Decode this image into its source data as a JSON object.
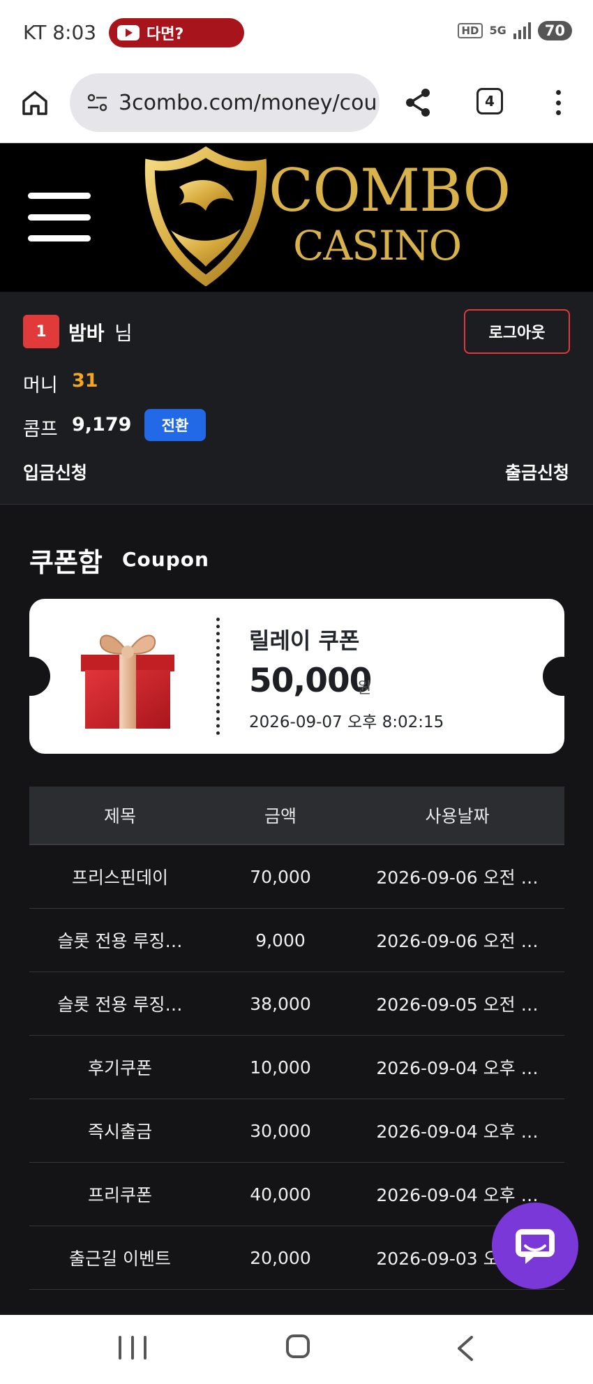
{
  "status_bar": {
    "carrier_time": "KT 8:03",
    "notification_text": "다면?",
    "hd": "HD",
    "network": "5G",
    "battery": "70"
  },
  "browser": {
    "url": "3combo.com/money/cou",
    "tab_count": "4"
  },
  "brand": {
    "line1": "COMBO",
    "line2": "CASINO",
    "gold_color": "#d9b24a"
  },
  "user": {
    "level": "1",
    "name": "밤바",
    "honorific": "님",
    "logout_label": "로그아웃",
    "money_label": "머니",
    "money_value": "31",
    "comp_label": "콤프",
    "comp_value": "9,179",
    "convert_label": "전환",
    "deposit_label": "입금신청",
    "withdraw_label": "출금신청"
  },
  "coupon_section": {
    "title": "쿠폰함",
    "subtitle": "Coupon",
    "featured": {
      "name": "릴레이 쿠폰",
      "amount": "50,000",
      "unit": "원",
      "date": "2026-09-07 오후 8:02:15"
    }
  },
  "table": {
    "headers": [
      "제목",
      "금액",
      "사용날짜"
    ],
    "rows": [
      [
        "프리스핀데이",
        "70,000",
        "2026-09-06 오전 …"
      ],
      [
        "슬롯 전용 루징…",
        "9,000",
        "2026-09-06 오전 …"
      ],
      [
        "슬롯 전용 루징…",
        "38,000",
        "2026-09-05 오전 …"
      ],
      [
        "후기쿠폰",
        "10,000",
        "2026-09-04 오후 …"
      ],
      [
        "즉시출금",
        "30,000",
        "2026-09-04 오후 …"
      ],
      [
        "프리쿠폰",
        "40,000",
        "2026-09-04 오후 …"
      ],
      [
        "출근길 이벤트",
        "20,000",
        "2026-09-03 오전 …"
      ]
    ]
  },
  "colors": {
    "accent_red": "#e03a3a",
    "money_yellow": "#f2a623",
    "button_blue": "#2169e6",
    "chat_purple": "#7b38d8"
  },
  "icons": [
    "home-icon",
    "site-settings-icon",
    "share-icon",
    "tabs-icon",
    "more-icon",
    "hamburger-icon",
    "gift-icon",
    "chat-icon",
    "recent-apps-icon",
    "home-nav-icon",
    "back-icon"
  ]
}
